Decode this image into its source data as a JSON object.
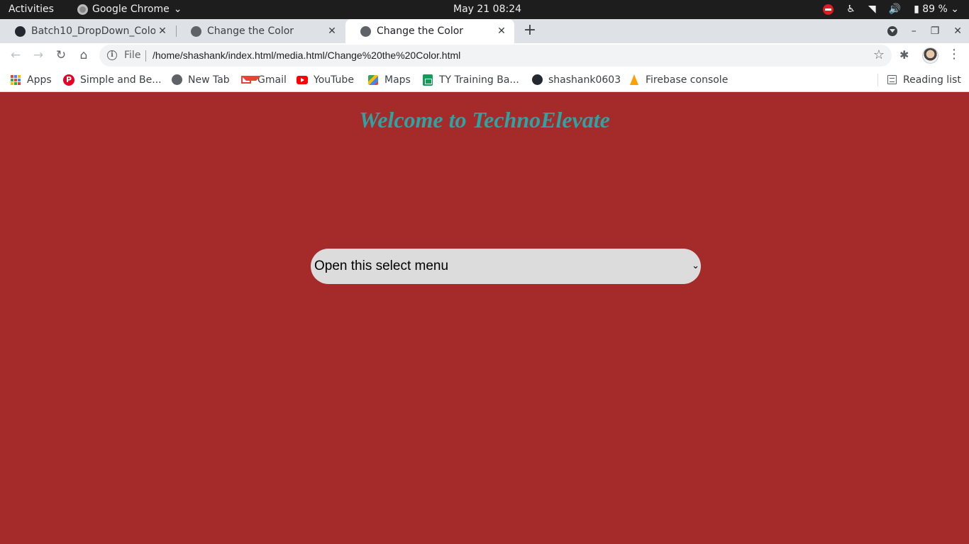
{
  "os_bar": {
    "activities": "Activities",
    "app_name": "Google Chrome",
    "clock": "May 21  08:24",
    "battery": "89 %"
  },
  "tabs": [
    {
      "title": "Batch10_DropDown_Colo",
      "icon": "github-icon",
      "active": false
    },
    {
      "title": "Change the Color",
      "icon": "globe-icon",
      "active": false
    },
    {
      "title": "Change the Color",
      "icon": "globe-icon",
      "active": true
    }
  ],
  "omnibox": {
    "scheme_label": "File",
    "url": "/home/shashank/index.html/media.html/Change%20the%20Color.html"
  },
  "bookmarks": [
    {
      "label": "Apps",
      "icon": "apps-grid-icon"
    },
    {
      "label": "Simple and Be...",
      "icon": "pinterest-icon"
    },
    {
      "label": "New Tab",
      "icon": "globe-icon"
    },
    {
      "label": "Gmail",
      "icon": "gmail-icon"
    },
    {
      "label": "YouTube",
      "icon": "youtube-icon"
    },
    {
      "label": "Maps",
      "icon": "maps-icon"
    },
    {
      "label": "TY Training Ba...",
      "icon": "sheets-icon"
    },
    {
      "label": "shashank0603",
      "icon": "github-icon"
    },
    {
      "label": "Firebase console",
      "icon": "firebase-icon"
    }
  ],
  "reading_list": "Reading list",
  "page": {
    "background": "#a52a2a",
    "heading": "Welcome to TechnoElevate",
    "heading_color": "#2ea3a3",
    "select": {
      "selected": "Open this select menu"
    }
  }
}
